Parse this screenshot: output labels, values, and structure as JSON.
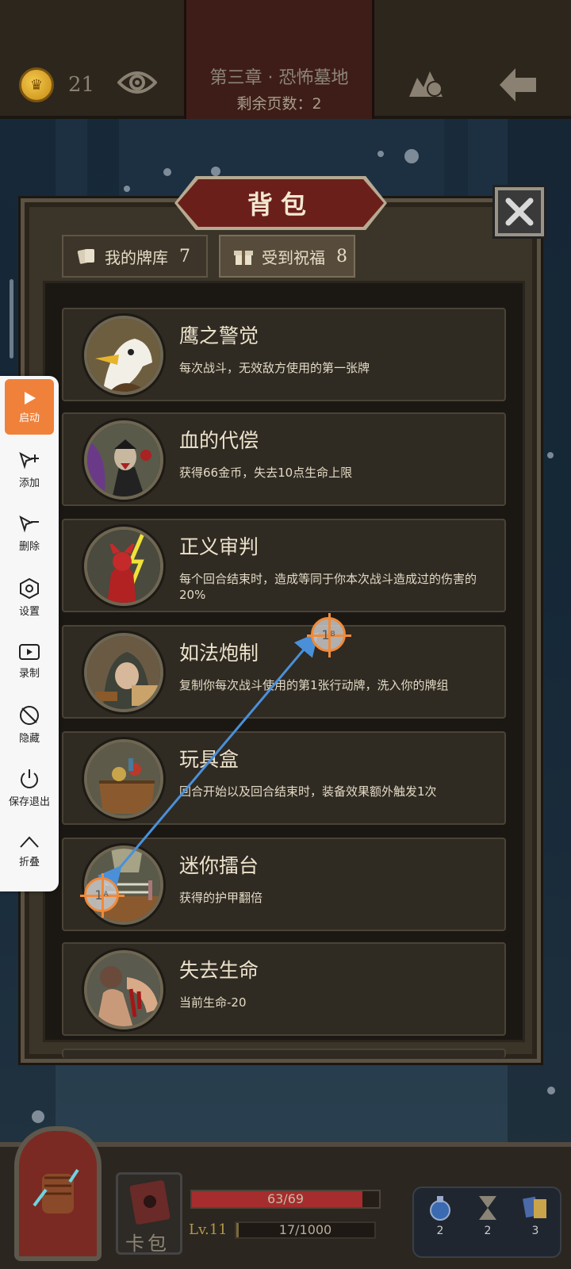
{
  "hud": {
    "gold": "21",
    "chapter_title": "第三章 · 恐怖墓地",
    "pages_left": "剩余页数：2"
  },
  "backpack": {
    "title": "背包",
    "tabs": [
      {
        "label": "我的牌库",
        "count": "7",
        "active": false
      },
      {
        "label": "受到祝福",
        "count": "8",
        "active": true
      }
    ],
    "items": [
      {
        "name": "鹰之警觉",
        "desc": "每次战斗，无效敌方使用的第一张牌",
        "icon": "eagle-icon"
      },
      {
        "name": "血的代偿",
        "desc": "获得66金币，失去10点生命上限",
        "icon": "vampire-icon"
      },
      {
        "name": "正义审判",
        "desc": "每个回合结束时，造成等同于你本次战斗造成过的伤害的20%",
        "icon": "red-demon-icon"
      },
      {
        "name": "如法炮制",
        "desc": "复制你每次战斗使用的第1张行动牌，洗入你的牌组",
        "icon": "hooded-man-icon"
      },
      {
        "name": "玩具盒",
        "desc": "回合开始以及回合结束时，装备效果额外触发1次",
        "icon": "toy-box-icon"
      },
      {
        "name": "迷你擂台",
        "desc": "获得的护甲翻倍",
        "icon": "boxing-ring-icon"
      },
      {
        "name": "失去生命",
        "desc": "当前生命-20",
        "icon": "bleeding-arm-icon"
      }
    ]
  },
  "toolbar": {
    "items": [
      {
        "label": "启动",
        "icon": "play-icon"
      },
      {
        "label": "添加",
        "icon": "add-pointer-icon"
      },
      {
        "label": "删除",
        "icon": "remove-pointer-icon"
      },
      {
        "label": "设置",
        "icon": "settings-hex-icon"
      },
      {
        "label": "录制",
        "icon": "record-icon"
      },
      {
        "label": "隐藏",
        "icon": "hide-icon"
      },
      {
        "label": "保存退出",
        "icon": "power-icon"
      },
      {
        "label": "折叠",
        "icon": "chevron-up-icon"
      }
    ]
  },
  "markers": {
    "a": {
      "num": "1",
      "tag": "A"
    },
    "b": {
      "num": "1",
      "tag": "B"
    }
  },
  "player": {
    "deck_label": "卡包",
    "hp": "63/69",
    "hp_fraction": 0.913,
    "level": "Lv.11",
    "xp": "17/1000",
    "xp_fraction": 0.017,
    "inventory": [
      {
        "icon": "potion-icon",
        "count": "2"
      },
      {
        "icon": "hourglass-icon",
        "count": "2"
      },
      {
        "icon": "cards-icon",
        "count": "3"
      }
    ]
  },
  "colors": {
    "accent_orange": "#f0813a",
    "banner_red": "#6b1f1b",
    "hp_red": "#a52d2d",
    "arrow_blue": "#4a90d9"
  }
}
